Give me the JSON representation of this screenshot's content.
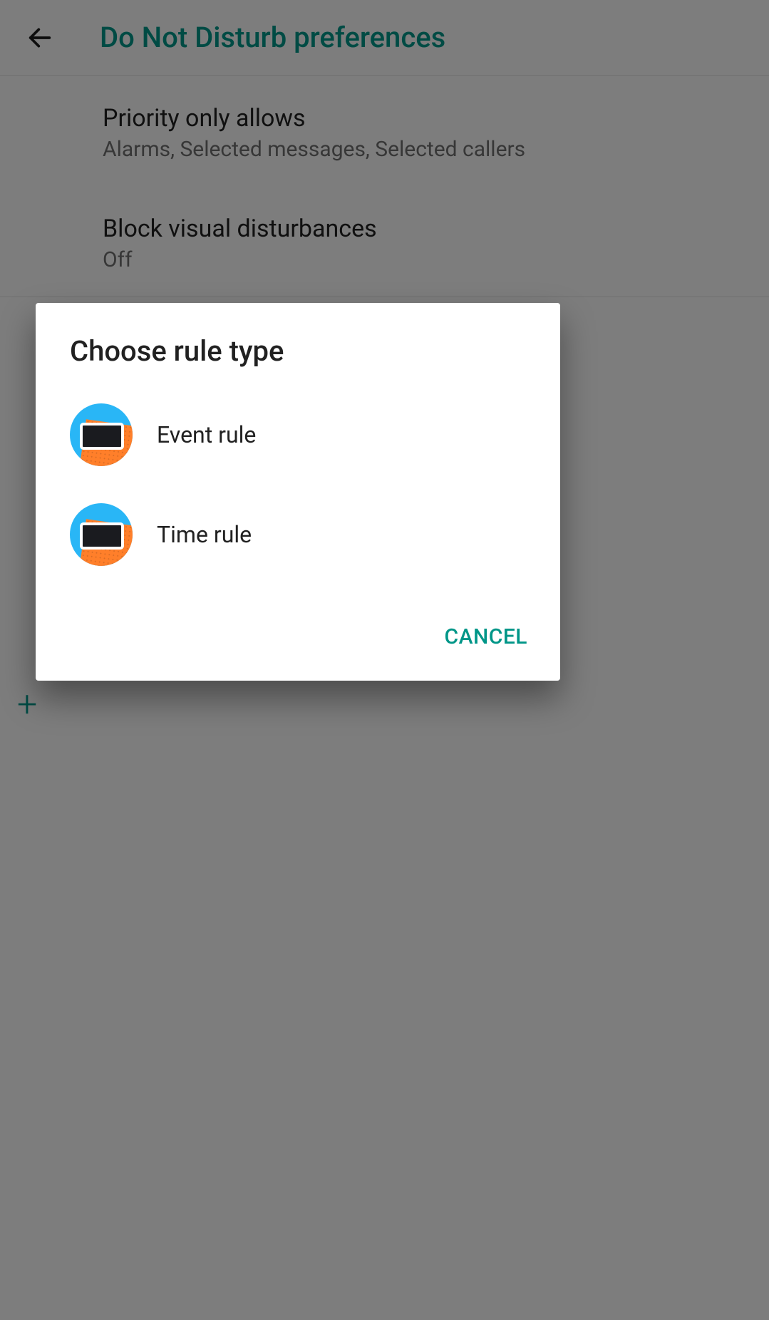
{
  "header": {
    "title": "Do Not Disturb preferences"
  },
  "settings": {
    "priority": {
      "title": "Priority only allows",
      "subtitle": "Alarms, Selected messages, Selected callers"
    },
    "block_visual": {
      "title": "Block visual disturbances",
      "subtitle": "Off"
    }
  },
  "add_label": "+",
  "dialog": {
    "title": "Choose rule type",
    "options": {
      "event": "Event rule",
      "time": "Time rule"
    },
    "cancel": "CANCEL"
  }
}
